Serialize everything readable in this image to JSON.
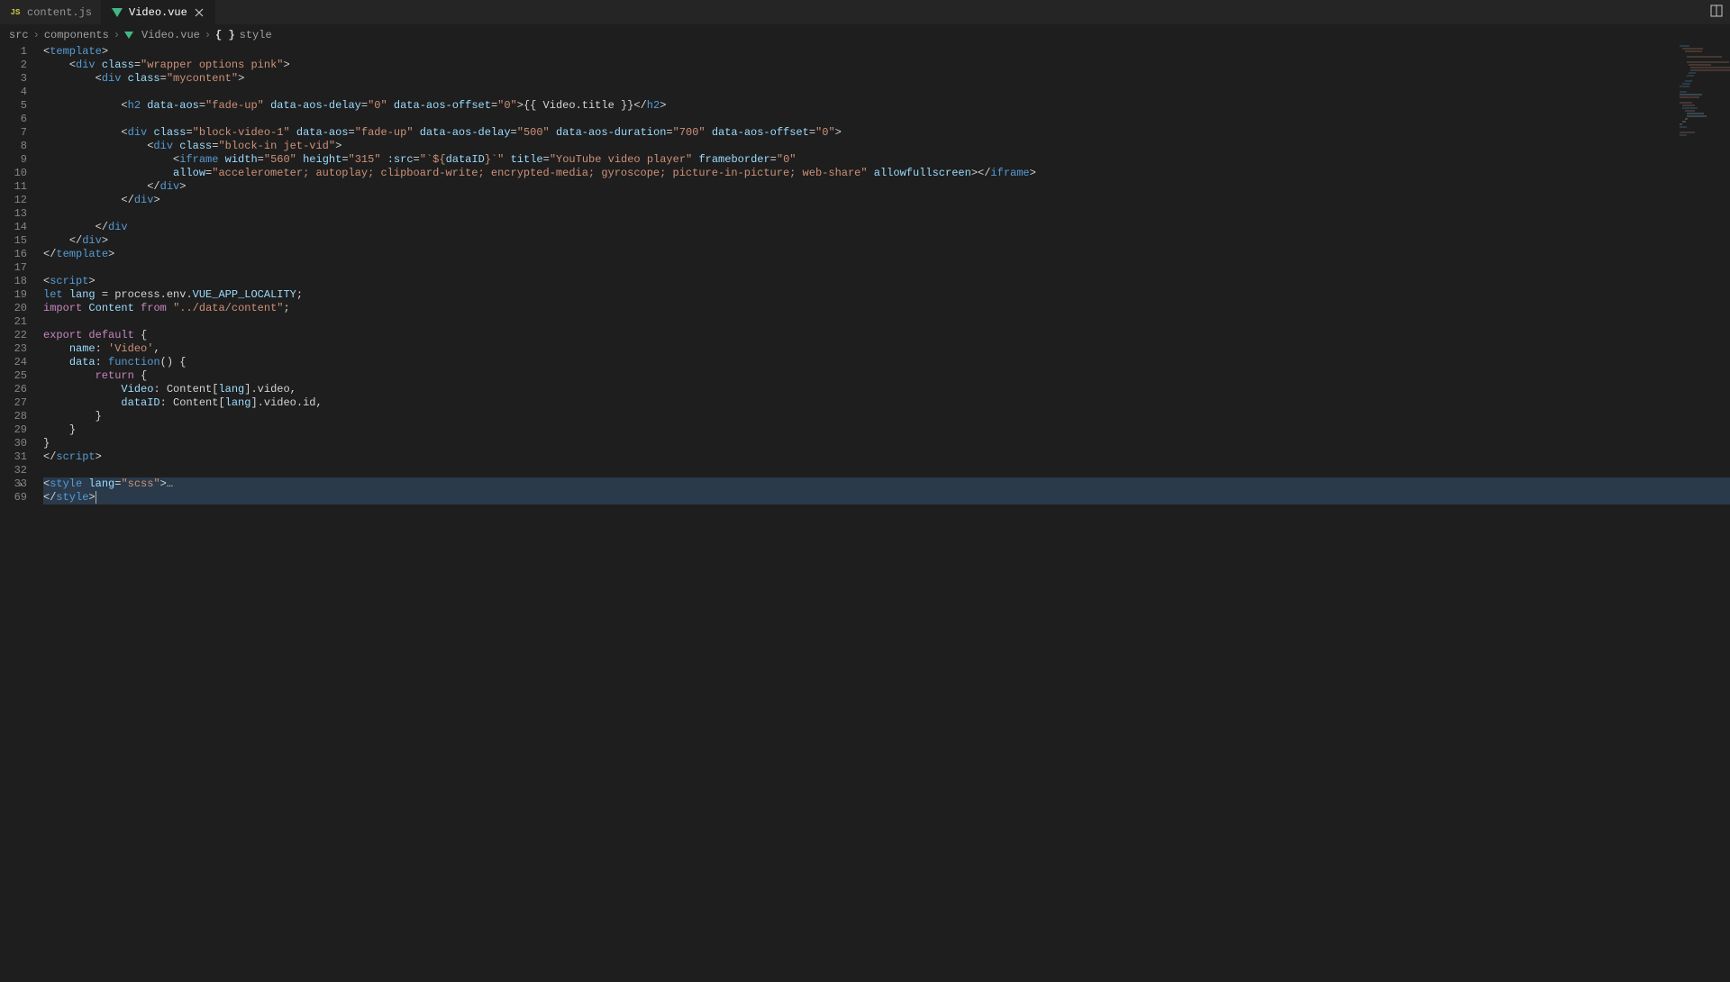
{
  "tabs": [
    {
      "label": "content.js",
      "active": false,
      "icon": "js"
    },
    {
      "label": "Video.vue",
      "active": true,
      "icon": "vue"
    }
  ],
  "split_icon": "split-editor",
  "breadcrumbs": {
    "src": "src",
    "components": "components",
    "file": "Video.vue",
    "section": "style"
  },
  "line_numbers": [
    "1",
    "2",
    "3",
    "4",
    "5",
    "6",
    "7",
    "8",
    "9",
    "10",
    "11",
    "12",
    "13",
    "14",
    "15",
    "16",
    "17",
    "18",
    "19",
    "20",
    "21",
    "22",
    "23",
    "24",
    "25",
    "26",
    "27",
    "28",
    "29",
    "30",
    "31",
    "32",
    "33",
    "69"
  ],
  "fold_line": "33",
  "code": {
    "l1": {
      "p": "",
      "a": "<",
      "b": "template",
      "c": ">"
    },
    "l2": {
      "p": "    ",
      "a": "<",
      "b": "div",
      "c": " ",
      "d": "class",
      "e": "=",
      "f": "\"wrapper options pink\"",
      "g": ">"
    },
    "l3": {
      "p": "        ",
      "a": "<",
      "b": "div",
      "c": " ",
      "d": "class",
      "e": "=",
      "f": "\"mycontent\"",
      "g": ">"
    },
    "l4": {
      "p": ""
    },
    "l5": {
      "p": "            ",
      "a": "<",
      "b": "h2",
      "c": " ",
      "d": "data-aos",
      "e": "=",
      "f": "\"fade-up\"",
      "g": " ",
      "h": "data-aos-delay",
      "i": "=",
      "j": "\"0\"",
      "k": " ",
      "l": "data-aos-offset",
      "m": "=",
      "n": "\"0\"",
      "o": ">",
      "p2": "{{ Video.title }}",
      "q": "</",
      "r": "h2",
      "s": ">"
    },
    "l6": {
      "p": ""
    },
    "l7": {
      "p": "            ",
      "a": "<",
      "b": "div",
      "c": " ",
      "d": "class",
      "e": "=",
      "f": "\"block-video-1\"",
      "g": " ",
      "h": "data-aos",
      "i": "=",
      "j": "\"fade-up\"",
      "k": " ",
      "l": "data-aos-delay",
      "m": "=",
      "n": "\"500\"",
      "o": " ",
      "p2": "data-aos-duration",
      "q": "=",
      "r": "\"700\"",
      "s": " ",
      "t": "data-aos-offset",
      "u": "=",
      "v": "\"0\"",
      "w": ">"
    },
    "l8": {
      "p": "                ",
      "a": "<",
      "b": "div",
      "c": " ",
      "d": "class",
      "e": "=",
      "f": "\"block-in jet-vid\"",
      "g": ">"
    },
    "l9": {
      "p": "                    ",
      "a": "<",
      "b": "iframe",
      "c": " ",
      "d": "width",
      "e": "=",
      "f": "\"560\"",
      "g": " ",
      "h": "height",
      "i": "=",
      "j": "\"315\"",
      "k": " ",
      "l": ":src",
      "m": "=",
      "n": "\"`${",
      "o": "dataID",
      "p2": "}`\"",
      "q": " ",
      "r": "title",
      "s": "=",
      "t": "\"YouTube video player\"",
      "u": " ",
      "v": "frameborder",
      "w": "=",
      "x": "\"0\""
    },
    "l10": {
      "p": "                    ",
      "a": "allow",
      "b": "=",
      "c": "\"accelerometer; autoplay; clipboard-write; encrypted-media; gyroscope; picture-in-picture; web-share\"",
      "d": " ",
      "e": "allowfullscreen",
      "f": "></",
      "g": "iframe",
      "h": ">"
    },
    "l11": {
      "p": "                ",
      "a": "</",
      "b": "div",
      "c": ">"
    },
    "l12": {
      "p": "            ",
      "a": "</",
      "b": "div",
      "c": ">"
    },
    "l13": {
      "p": ""
    },
    "l14": {
      "p": "        ",
      "a": "</",
      "b": "div",
      "c": ">"
    },
    "l15": {
      "p": "    ",
      "a": "</",
      "b": "div",
      "c": ">"
    },
    "l16": {
      "p": "",
      "a": "</",
      "b": "template",
      "c": ">"
    },
    "l17": {
      "p": ""
    },
    "l18": {
      "p": "",
      "a": "<",
      "b": "script",
      "c": ">"
    },
    "l19": {
      "p": "",
      "a": "let",
      "b": " ",
      "c": "lang",
      "d": " = process.env.",
      "e": "VUE_APP_LOCALITY",
      "f": ";"
    },
    "l20": {
      "p": "",
      "a": "import",
      "b": " ",
      "c": "Content",
      "d": " ",
      "e": "from",
      "f": " ",
      "g": "\"../data/content\"",
      "h": ";"
    },
    "l21": {
      "p": ""
    },
    "l22": {
      "p": "",
      "a": "export",
      "b": " ",
      "c": "default",
      "d": " {"
    },
    "l23": {
      "p": "    ",
      "a": "name",
      "b": ": ",
      "c": "'Video'",
      "d": ","
    },
    "l24": {
      "p": "    ",
      "a": "data",
      "b": ": ",
      "c": "function",
      "d": "() {"
    },
    "l25": {
      "p": "        ",
      "a": "return",
      "b": " {"
    },
    "l26": {
      "p": "            ",
      "a": "Video",
      "b": ": Content[",
      "c": "lang",
      "d": "].video,"
    },
    "l27": {
      "p": "            ",
      "a": "dataID",
      "b": ": Content[",
      "c": "lang",
      "d": "].video.id,"
    },
    "l28": {
      "p": "        ",
      "a": "}"
    },
    "l29": {
      "p": "    ",
      "a": "}"
    },
    "l30": {
      "p": "",
      "a": "}"
    },
    "l31": {
      "p": "",
      "a": "</",
      "b": "script",
      "c": ">"
    },
    "l32": {
      "p": ""
    },
    "l33": {
      "p": "",
      "a": "<",
      "b": "style",
      "c": " ",
      "d": "lang",
      "e": "=",
      "f": "\"scss\"",
      "g": ">",
      "h": "…"
    },
    "l69": {
      "p": "",
      "a": "</",
      "b": "style",
      "c": ">"
    }
  }
}
